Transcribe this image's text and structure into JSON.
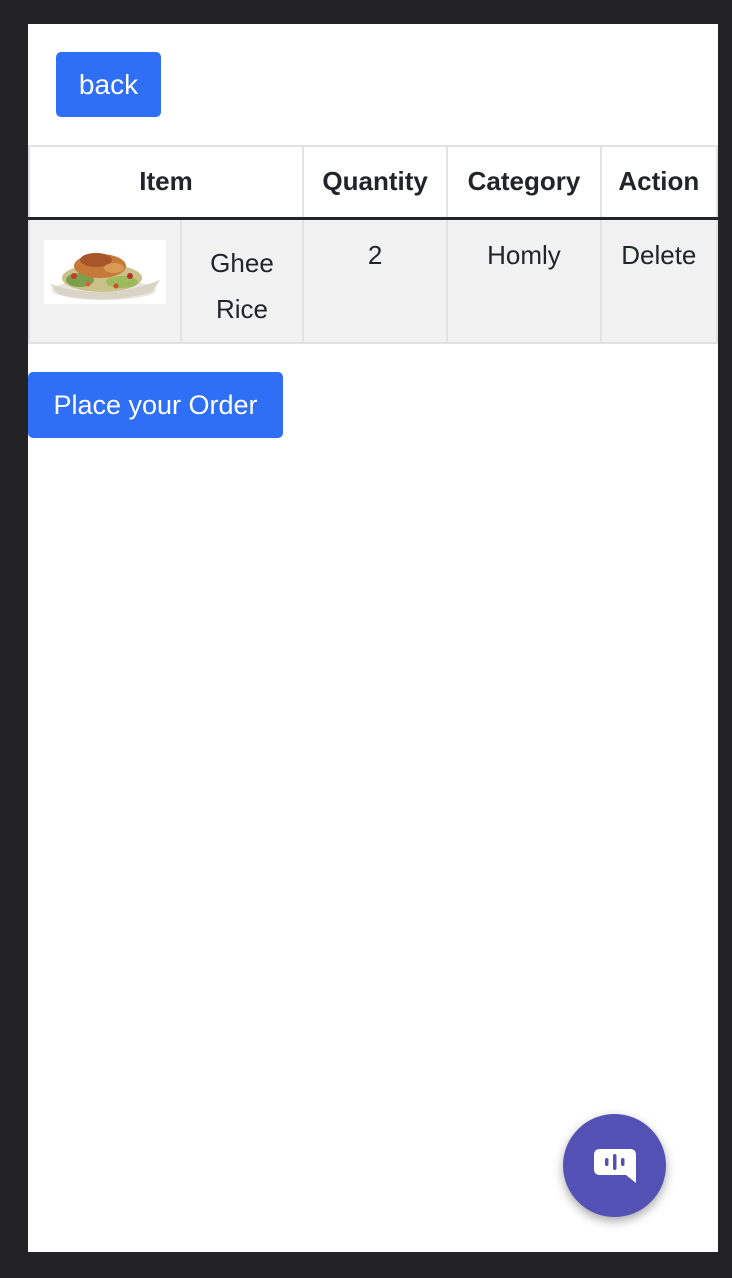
{
  "header": {
    "back_label": "back"
  },
  "table": {
    "columns": [
      "Item",
      "Quantity",
      "Category",
      "Action"
    ],
    "rows": [
      {
        "name": "Ghee Rice",
        "quantity": "2",
        "category": "Homly",
        "action": "Delete"
      }
    ]
  },
  "order_button": {
    "label": "Place your Order"
  },
  "colors": {
    "primary": "#2f6ff5",
    "chat_fab": "#5451b5",
    "frame": "#232325",
    "row_bg": "#f2f2f2"
  },
  "icons": {
    "chat": "chat-bubble-icon",
    "food": "food-image"
  }
}
